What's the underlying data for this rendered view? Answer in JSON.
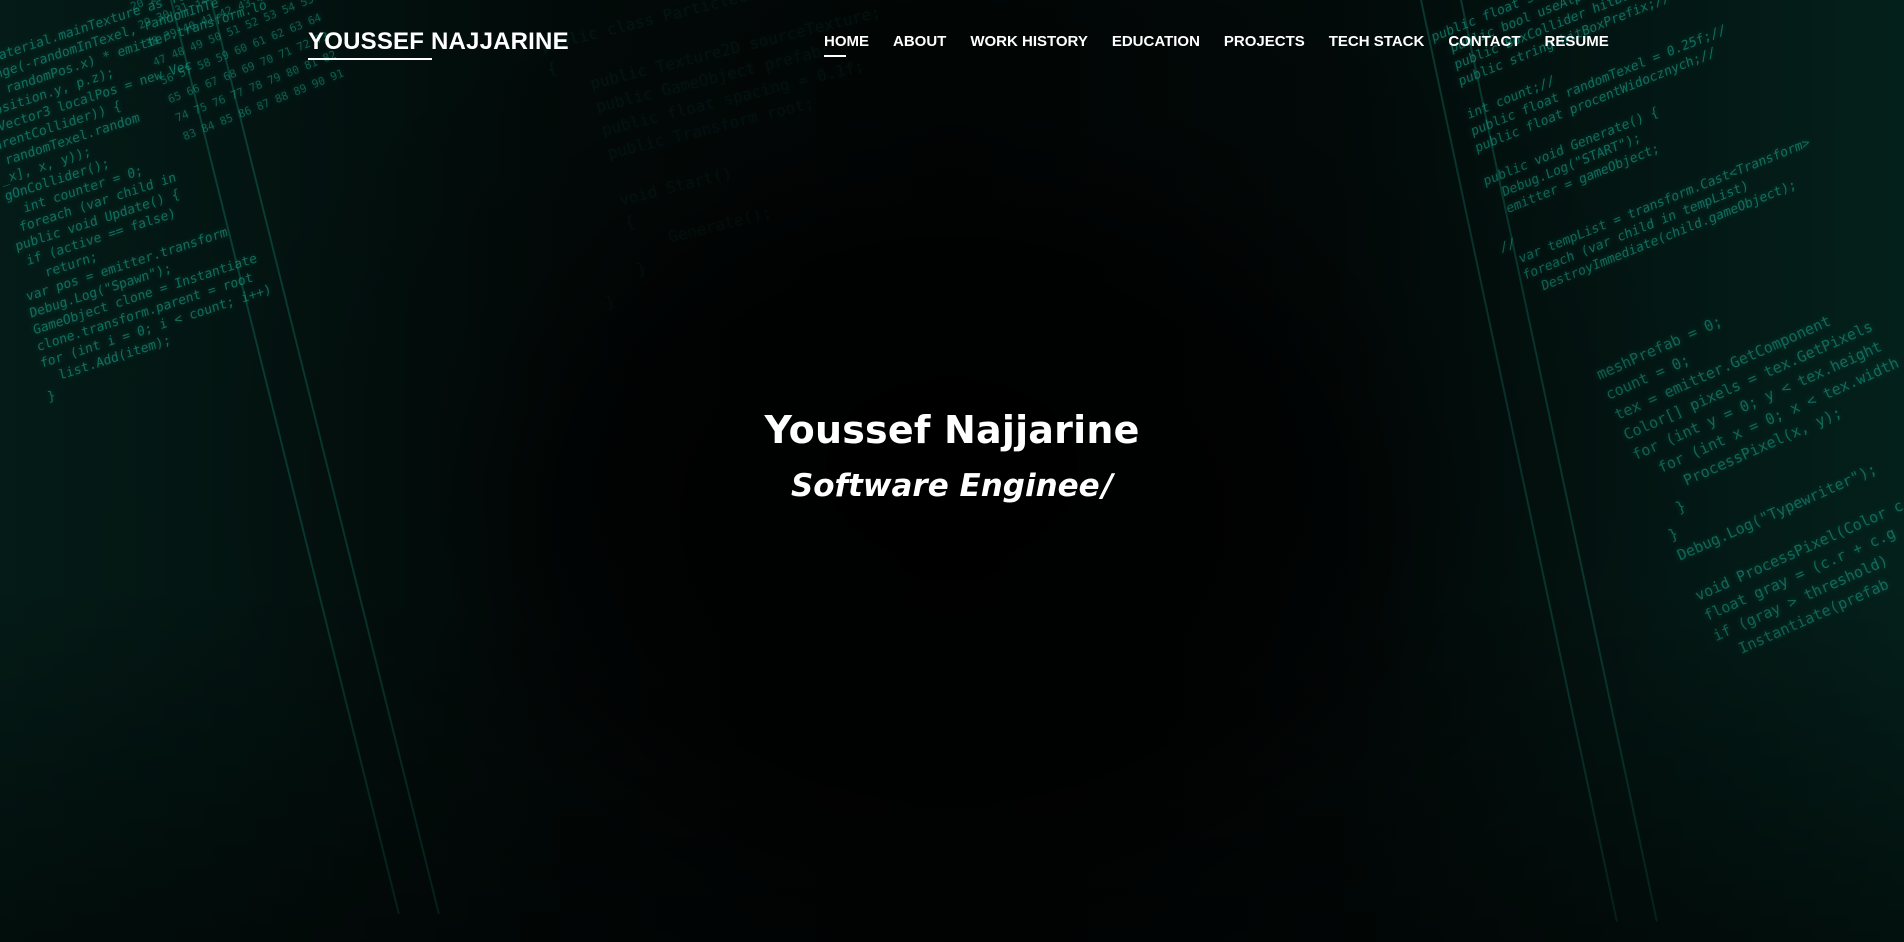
{
  "header": {
    "brand": "YOUSSEF NAJJARINE",
    "nav": [
      {
        "label": "HOME",
        "active": true
      },
      {
        "label": "ABOUT",
        "active": false
      },
      {
        "label": "WORK HISTORY",
        "active": false
      },
      {
        "label": "EDUCATION",
        "active": false
      },
      {
        "label": "PROJECTS",
        "active": false
      },
      {
        "label": "TECH STACK",
        "active": false
      },
      {
        "label": "CONTACT",
        "active": false
      },
      {
        "label": "RESUME",
        "active": false
      }
    ]
  },
  "hero": {
    "name": "Youssef Najjarine",
    "role_typed": "Software Enginee",
    "cursor": "/"
  },
  "background": {
    "theme": "teal code on black",
    "accent": "#1fb59a",
    "base": "#000000"
  }
}
